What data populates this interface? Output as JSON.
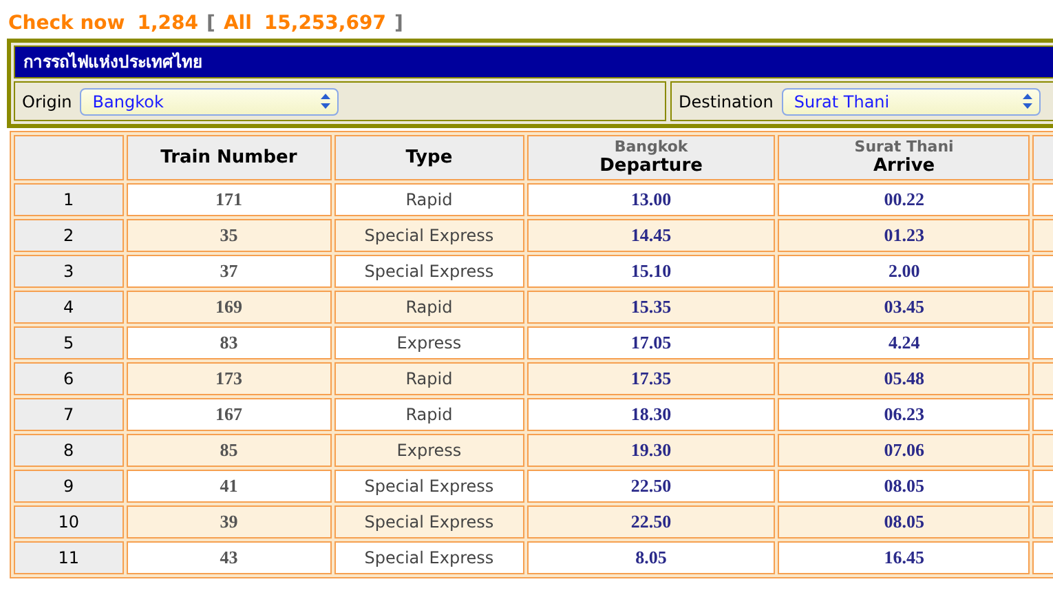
{
  "counter": {
    "label": "Check now",
    "value": "1,284",
    "open_bracket": "[",
    "close_bracket": "]",
    "all_label": "All",
    "all_value": "15,253,697"
  },
  "panel": {
    "title": "การรถไฟแห่งประเทศไทย",
    "origin": {
      "label": "Origin",
      "value": "Bangkok"
    },
    "destination": {
      "label": "Destination",
      "value": "Surat Thani"
    }
  },
  "table": {
    "columns": [
      {},
      {
        "title": "Train Number"
      },
      {
        "title": "Type"
      },
      {
        "title": "Departure",
        "subtitle": "Bangkok"
      },
      {
        "title": "Arrive",
        "subtitle": "Surat Thani"
      }
    ],
    "rows": [
      [
        "1",
        "171",
        "Rapid",
        "13.00",
        "00.22"
      ],
      [
        "2",
        "35",
        "Special Express",
        "14.45",
        "01.23"
      ],
      [
        "3",
        "37",
        "Special Express",
        "15.10",
        "2.00"
      ],
      [
        "4",
        "169",
        "Rapid",
        "15.35",
        "03.45"
      ],
      [
        "5",
        "83",
        "Express",
        "17.05",
        "4.24"
      ],
      [
        "6",
        "173",
        "Rapid",
        "17.35",
        "05.48"
      ],
      [
        "7",
        "167",
        "Rapid",
        "18.30",
        "06.23"
      ],
      [
        "8",
        "85",
        "Express",
        "19.30",
        "07.06"
      ],
      [
        "9",
        "41",
        "Special Express",
        "22.50",
        "08.05"
      ],
      [
        "10",
        "39",
        "Special Express",
        "22.50",
        "08.05"
      ],
      [
        "11",
        "43",
        "Special Express",
        "8.05",
        "16.45"
      ]
    ]
  }
}
